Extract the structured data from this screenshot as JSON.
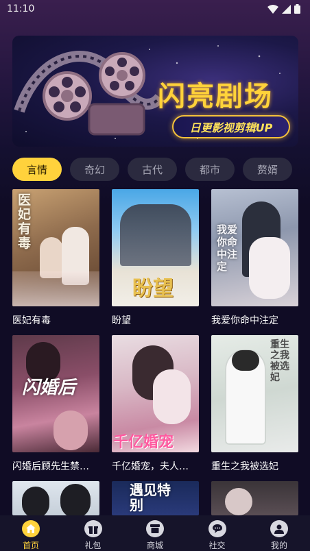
{
  "status_bar": {
    "time": "11:10"
  },
  "banner": {
    "title": "闪亮剧场",
    "subtitle": "日更影视剪辑UP"
  },
  "tabs": [
    {
      "label": "言情",
      "active": true
    },
    {
      "label": "奇幻",
      "active": false
    },
    {
      "label": "古代",
      "active": false
    },
    {
      "label": "都市",
      "active": false
    },
    {
      "label": "赘婿",
      "active": false
    }
  ],
  "dramas": [
    {
      "title": "医妃有毒",
      "poster_text": "医妃有毒"
    },
    {
      "title": "盼望",
      "poster_text": "盼望"
    },
    {
      "title": "我爱你命中注定",
      "poster_text": "我爱你命中注定"
    },
    {
      "title": "闪婚后顾先生禁…",
      "poster_text": "闪婚后"
    },
    {
      "title": "千亿婚宠，夫人…",
      "poster_text": "千亿婚宠"
    },
    {
      "title": "重生之我被选妃",
      "poster_text": "重生之我被选妃"
    },
    {
      "title": "",
      "poster_text": ""
    },
    {
      "title": "",
      "poster_text": "遇见特别"
    },
    {
      "title": "",
      "poster_text": ""
    }
  ],
  "bottom_nav": [
    {
      "label": "首页",
      "icon": "home-icon",
      "active": true
    },
    {
      "label": "礼包",
      "icon": "gift-icon",
      "active": false
    },
    {
      "label": "商城",
      "icon": "store-icon",
      "active": false
    },
    {
      "label": "社交",
      "icon": "chat-icon",
      "active": false
    },
    {
      "label": "我的",
      "icon": "user-icon",
      "active": false
    }
  ],
  "colors": {
    "accent": "#ffd23c",
    "background": "#100c25",
    "tab_inactive": "#2b2a3f"
  }
}
